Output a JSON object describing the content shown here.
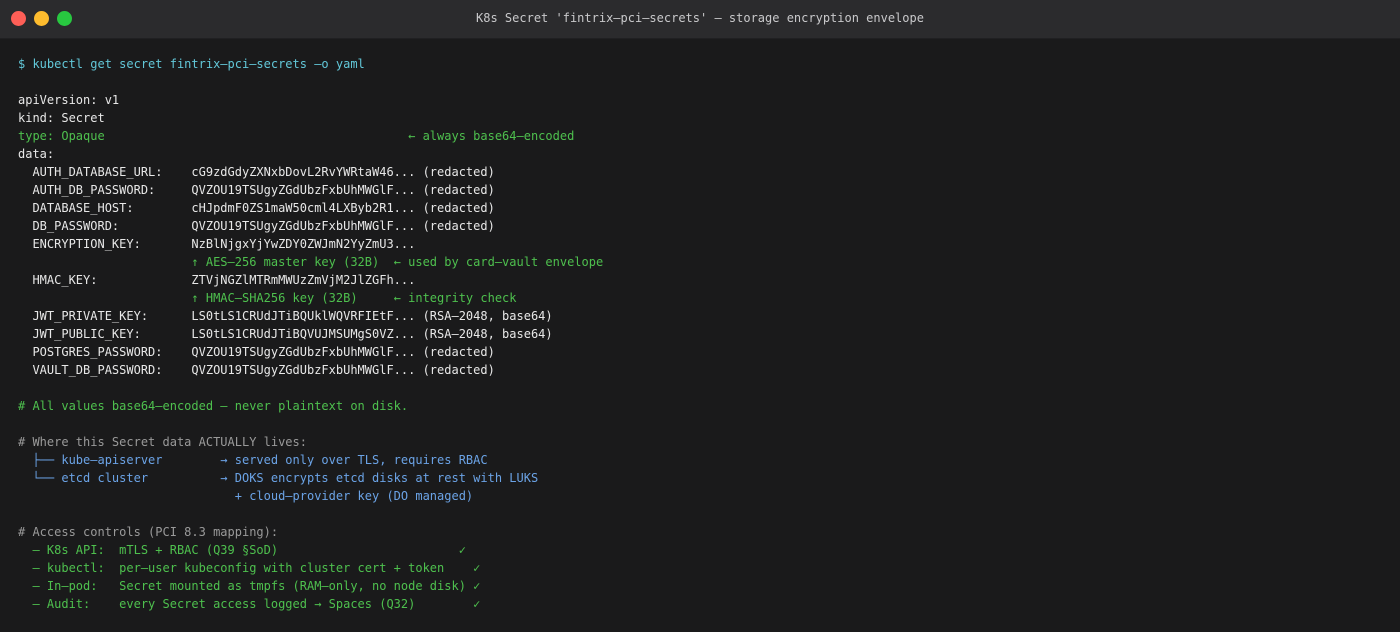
{
  "window": {
    "title": "K8s Secret 'fintrix–pci–secrets' — storage encryption envelope",
    "colors": {
      "close": "#fe5f57",
      "minimize": "#febc2e",
      "maximize": "#28c840",
      "background": "#1a1a1b"
    }
  },
  "terminal": {
    "lines": [
      {
        "text": "$ kubectl get secret fintrix–pci–secrets –o yaml",
        "color": "cyan"
      },
      {
        "text": "",
        "color": "white"
      },
      {
        "text": "apiVersion: v1",
        "color": "white"
      },
      {
        "text": "kind: Secret",
        "color": "white"
      },
      {
        "text": "type: Opaque                                          ← always base64–encoded",
        "color": "green"
      },
      {
        "text": "data:",
        "color": "white"
      },
      {
        "text": "  AUTH_DATABASE_URL:    cG9zdGdyZXNxbDovL2RvYWRtaW46... (redacted)",
        "color": "white"
      },
      {
        "text": "  AUTH_DB_PASSWORD:     QVZOU19TSUgyZGdUbzFxbUhMWGlF... (redacted)",
        "color": "white"
      },
      {
        "text": "  DATABASE_HOST:        cHJpdmF0ZS1maW50cml4LXByb2R1... (redacted)",
        "color": "white"
      },
      {
        "text": "  DB_PASSWORD:          QVZOU19TSUgyZGdUbzFxbUhMWGlF... (redacted)",
        "color": "white"
      },
      {
        "text": "  ENCRYPTION_KEY:       NzBlNjgxYjYwZDY0ZWJmN2YyZmU3...",
        "color": "white"
      },
      {
        "text": "                        ↑ AES–256 master key (32B)  ← used by card–vault envelope",
        "color": "green"
      },
      {
        "text": "  HMAC_KEY:             ZTVjNGZlMTRmMWUzZmVjM2JlZGFh...",
        "color": "white"
      },
      {
        "text": "                        ↑ HMAC–SHA256 key (32B)     ← integrity check",
        "color": "green"
      },
      {
        "text": "  JWT_PRIVATE_KEY:      LS0tLS1CRUdJTiBQUklWQVRFIEtF... (RSA–2048, base64)",
        "color": "white"
      },
      {
        "text": "  JWT_PUBLIC_KEY:       LS0tLS1CRUdJTiBQVUJMSUMgS0VZ... (RSA–2048, base64)",
        "color": "white"
      },
      {
        "text": "  POSTGRES_PASSWORD:    QVZOU19TSUgyZGdUbzFxbUhMWGlF... (redacted)",
        "color": "white"
      },
      {
        "text": "  VAULT_DB_PASSWORD:    QVZOU19TSUgyZGdUbzFxbUhMWGlF... (redacted)",
        "color": "white"
      },
      {
        "text": "",
        "color": "white"
      },
      {
        "text": "# All values base64–encoded — never plaintext on disk.",
        "color": "green"
      },
      {
        "text": "",
        "color": "white"
      },
      {
        "text": "# Where this Secret data ACTUALLY lives:",
        "color": "grey"
      },
      {
        "text": "  ├── kube–apiserver        → served only over TLS, requires RBAC",
        "color": "blue"
      },
      {
        "text": "  └── etcd cluster          → DOKS encrypts etcd disks at rest with LUKS",
        "color": "blue"
      },
      {
        "text": "                              + cloud–provider key (DO managed)",
        "color": "blue"
      },
      {
        "text": "",
        "color": "white"
      },
      {
        "text": "# Access controls (PCI 8.3 mapping):",
        "color": "grey"
      },
      {
        "text": "  – K8s API:  mTLS + RBAC (Q39 §SoD)                         ✓",
        "color": "green"
      },
      {
        "text": "  – kubectl:  per–user kubeconfig with cluster cert + token    ✓",
        "color": "green"
      },
      {
        "text": "  – In–pod:   Secret mounted as tmpfs (RAM–only, no node disk) ✓",
        "color": "green"
      },
      {
        "text": "  – Audit:    every Secret access logged → Spaces (Q32)        ✓",
        "color": "green"
      }
    ]
  }
}
